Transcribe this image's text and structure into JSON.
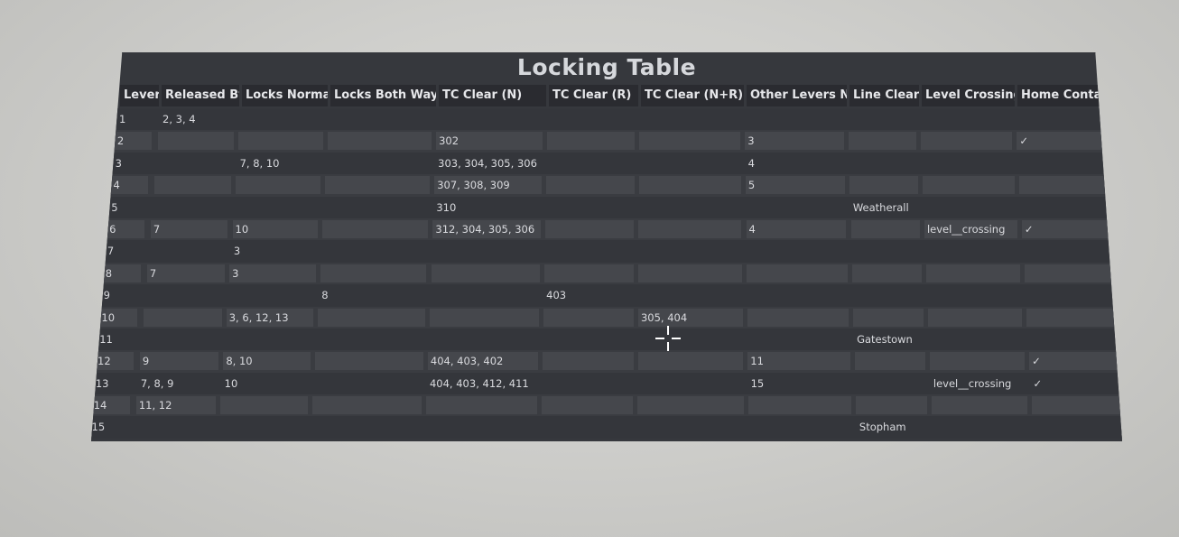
{
  "title": "Locking Table",
  "headers": [
    "Lever",
    "Released By",
    "Locks Normal",
    "Locks Both Ways",
    "TC Clear (N)",
    "TC Clear (R)",
    "TC Clear (N+R)",
    "Other Levers N",
    "Line Clear",
    "Level Crossing",
    "Home Contact"
  ],
  "rows": [
    [
      "1",
      "2, 3, 4",
      "",
      "",
      "",
      "",
      "",
      "",
      "",
      "",
      ""
    ],
    [
      "2",
      "",
      "",
      "",
      "302",
      "",
      "",
      "3",
      "",
      "",
      "✓"
    ],
    [
      "3",
      "",
      "7, 8, 10",
      "",
      "303, 304, 305, 306",
      "",
      "",
      "4",
      "",
      "",
      ""
    ],
    [
      "4",
      "",
      "",
      "",
      "307, 308, 309",
      "",
      "",
      "5",
      "",
      "",
      ""
    ],
    [
      "5",
      "",
      "",
      "",
      "310",
      "",
      "",
      "",
      "Weatherall",
      "",
      ""
    ],
    [
      "6",
      "7",
      "10",
      "",
      "312, 304, 305, 306",
      "",
      "",
      "4",
      "",
      "level__crossing",
      "✓"
    ],
    [
      "7",
      "",
      "3",
      "",
      "",
      "",
      "",
      "",
      "",
      "",
      ""
    ],
    [
      "8",
      "7",
      "3",
      "",
      "",
      "",
      "",
      "",
      "",
      "",
      ""
    ],
    [
      "9",
      "",
      "",
      "8",
      "",
      "403",
      "",
      "",
      "",
      "",
      ""
    ],
    [
      "10",
      "",
      "3, 6, 12, 13",
      "",
      "",
      "",
      "305, 404",
      "",
      "",
      "",
      ""
    ],
    [
      "11",
      "",
      "",
      "",
      "",
      "",
      "",
      "",
      "Gatestown",
      "",
      ""
    ],
    [
      "12",
      "9",
      "8, 10",
      "",
      "404, 403, 402",
      "",
      "",
      "11",
      "",
      "",
      "✓"
    ],
    [
      "13",
      "7, 8, 9",
      "10",
      "",
      "404, 403, 412, 411",
      "",
      "",
      "15",
      "",
      "level__crossing",
      "✓"
    ],
    [
      "14",
      "11, 12",
      "",
      "",
      "",
      "",
      "",
      "",
      "",
      "",
      ""
    ],
    [
      "15",
      "",
      "",
      "",
      "",
      "",
      "",
      "",
      "Stopham",
      "",
      ""
    ]
  ]
}
